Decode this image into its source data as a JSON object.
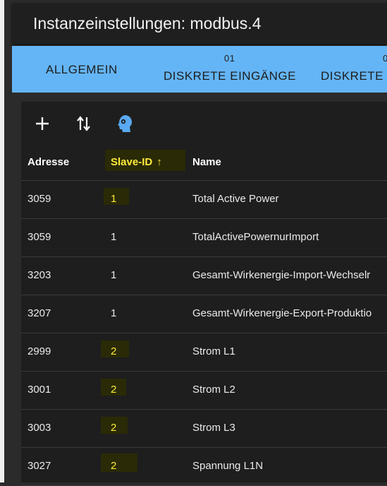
{
  "window": {
    "title": "Instanzeinstellungen: modbus.4"
  },
  "tabs": [
    {
      "label": "ALLGEMEIN",
      "count": ""
    },
    {
      "label": "DISKRETE EINGÄNGE",
      "count": "01"
    },
    {
      "label": "DISKRETE",
      "count": "0"
    }
  ],
  "toolbar": {
    "add": "add-icon",
    "sort": "sort-icon",
    "import": "face-icon"
  },
  "table": {
    "headers": {
      "address": "Adresse",
      "slave_id": "Slave-ID",
      "name": "Name",
      "sort_indicator": "↑"
    },
    "rows": [
      {
        "address": "3059",
        "slave_id": "1",
        "name": "Total Active Power"
      },
      {
        "address": "3059",
        "slave_id": "1",
        "name": "TotalActivePowernurImport"
      },
      {
        "address": "3203",
        "slave_id": "1",
        "name": "Gesamt-Wirkenergie-Import-Wechselr"
      },
      {
        "address": "3207",
        "slave_id": "1",
        "name": "Gesamt-Wirkenergie-Export-Produktio"
      },
      {
        "address": "2999",
        "slave_id": "2",
        "name": "Strom L1"
      },
      {
        "address": "3001",
        "slave_id": "2",
        "name": "Strom L2"
      },
      {
        "address": "3003",
        "slave_id": "2",
        "name": "Strom L3"
      },
      {
        "address": "3027",
        "slave_id": "2",
        "name": "Spannung L1N"
      }
    ]
  },
  "colors": {
    "accent": "#64b5f6",
    "highlight": "#ffeb3b",
    "panel": "#1e1e1e"
  }
}
